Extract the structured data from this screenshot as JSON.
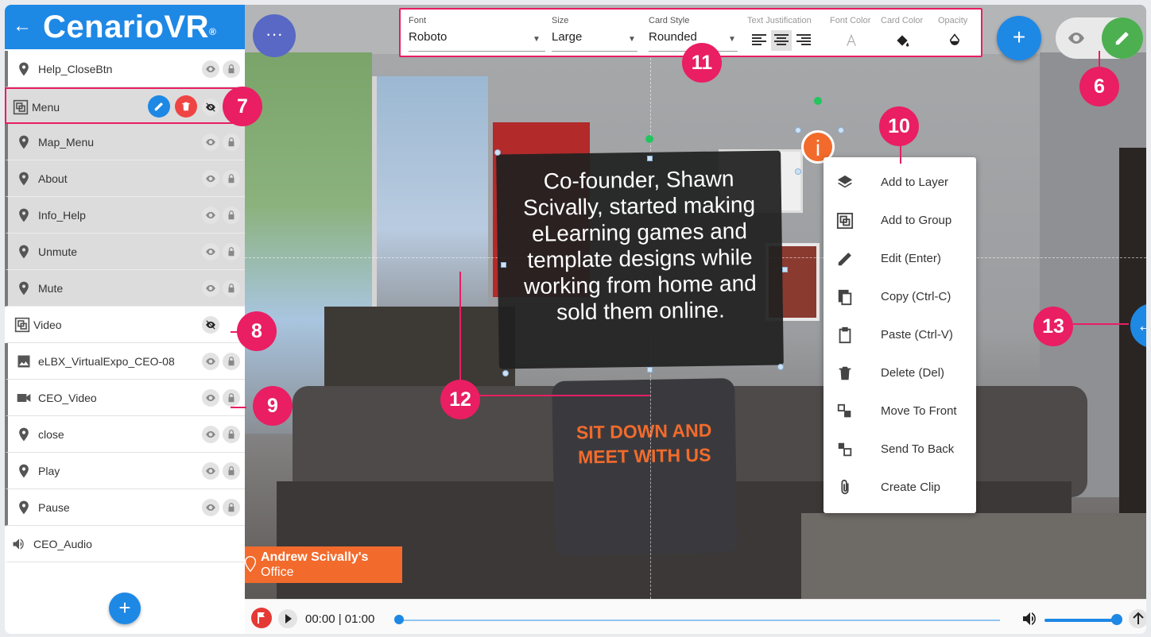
{
  "app": {
    "brand": "CenarioVR",
    "trademark": "®"
  },
  "sidebar": {
    "layers": [
      {
        "label": "Help_CloseBtn",
        "icon": "map-pin-icon"
      },
      {
        "label": "Menu",
        "icon": "group-icon"
      },
      {
        "label": "Map_Menu",
        "icon": "map-pin-icon"
      },
      {
        "label": "About",
        "icon": "map-pin-icon"
      },
      {
        "label": "Info_Help",
        "icon": "map-pin-icon"
      },
      {
        "label": "Unmute",
        "icon": "map-pin-icon"
      },
      {
        "label": "Mute",
        "icon": "map-pin-icon"
      },
      {
        "label": "Video",
        "icon": "group-icon"
      },
      {
        "label": "eLBX_VirtualExpo_CEO-08",
        "icon": "image-icon"
      },
      {
        "label": "CEO_Video",
        "icon": "video-camera-icon"
      },
      {
        "label": "close",
        "icon": "map-pin-icon"
      },
      {
        "label": "Play",
        "icon": "map-pin-icon"
      },
      {
        "label": "Pause",
        "icon": "map-pin-icon"
      },
      {
        "label": "CEO_Audio",
        "icon": "speaker-icon"
      }
    ],
    "add_label": "+"
  },
  "toolbar": {
    "font_caption": "Font",
    "font_value": "Roboto",
    "size_caption": "Size",
    "size_value": "Large",
    "card_style_caption": "Card Style",
    "card_style_value": "Rounded",
    "text_justification_caption": "Text Justification",
    "font_color_caption": "Font Color",
    "card_color_caption": "Card Color",
    "opacity_caption": "Opacity"
  },
  "scene": {
    "card_text": "Co-founder, Shawn Scivally, started making eLearning games and template designs while working from home and sold them online.",
    "pillow_text": "SIT DOWN AND MEET WITH US",
    "info_symbol": "i",
    "office_tag_line1": "Andrew Scivally's",
    "office_tag_line2": "Office",
    "more_label": "···",
    "add_object_label": "+",
    "collapse_label": "←"
  },
  "context_menu": [
    {
      "label": "Add to Layer",
      "icon": "layers-icon"
    },
    {
      "label": "Add to Group",
      "icon": "group-icon"
    },
    {
      "label": "Edit (Enter)",
      "icon": "pencil-icon"
    },
    {
      "label": "Copy (Ctrl-C)",
      "icon": "copy-icon"
    },
    {
      "label": "Paste (Ctrl-V)",
      "icon": "clipboard-icon"
    },
    {
      "label": "Delete (Del)",
      "icon": "trash-icon"
    },
    {
      "label": "Move To Front",
      "icon": "bring-front-icon"
    },
    {
      "label": "Send To Back",
      "icon": "send-back-icon"
    },
    {
      "label": "Create Clip",
      "icon": "paperclip-icon"
    }
  ],
  "badges": {
    "b6": "6",
    "b7": "7",
    "b8": "8",
    "b9": "9",
    "b10": "10",
    "b11": "11",
    "b12": "12",
    "b13": "13"
  },
  "timeline": {
    "time": "00:00 | 01:00",
    "progress": 0.0,
    "volume": 1.0
  },
  "colors": {
    "primary": "#1e88e5",
    "accent": "#e91e63",
    "edit_green": "#4caf50",
    "delete_red": "#ef4444",
    "orange": "#f26b2c"
  }
}
